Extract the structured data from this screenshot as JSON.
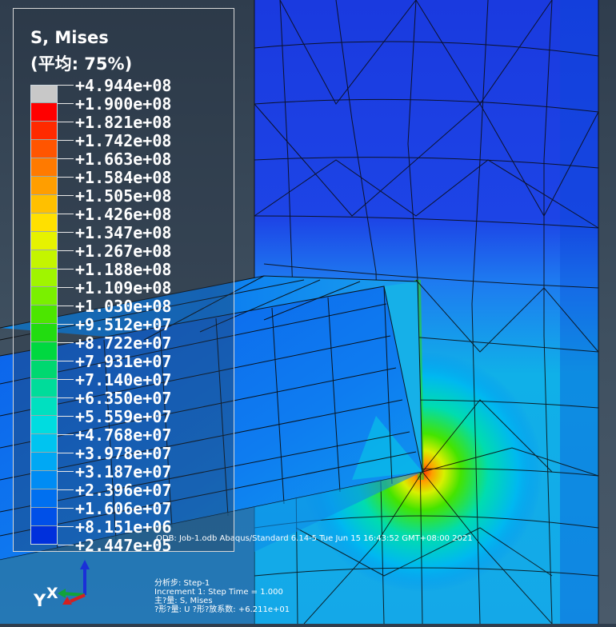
{
  "legend": {
    "title": "S, Mises",
    "subtitle": "(平均: 75%)",
    "entries": [
      {
        "label": "+4.944e+08",
        "color": "#c8c8c8"
      },
      {
        "label": "+1.900e+08",
        "color": "#ff0000"
      },
      {
        "label": "+1.821e+08",
        "color": "#ff2a00"
      },
      {
        "label": "+1.742e+08",
        "color": "#ff5500"
      },
      {
        "label": "+1.663e+08",
        "color": "#ff7a00"
      },
      {
        "label": "+1.584e+08",
        "color": "#ff9e00"
      },
      {
        "label": "+1.505e+08",
        "color": "#ffc000"
      },
      {
        "label": "+1.426e+08",
        "color": "#ffe000"
      },
      {
        "label": "+1.347e+08",
        "color": "#e6f200"
      },
      {
        "label": "+1.267e+08",
        "color": "#c4f500"
      },
      {
        "label": "+1.188e+08",
        "color": "#a0f500"
      },
      {
        "label": "+1.109e+08",
        "color": "#7af000"
      },
      {
        "label": "+1.030e+08",
        "color": "#4ce600"
      },
      {
        "label": "+9.512e+07",
        "color": "#22dc10"
      },
      {
        "label": "+8.722e+07",
        "color": "#00d840"
      },
      {
        "label": "+7.931e+07",
        "color": "#00d870"
      },
      {
        "label": "+7.140e+07",
        "color": "#00dc9a"
      },
      {
        "label": "+6.350e+07",
        "color": "#00e0c0"
      },
      {
        "label": "+5.559e+07",
        "color": "#00dce0"
      },
      {
        "label": "+4.768e+07",
        "color": "#00c4f0"
      },
      {
        "label": "+3.978e+07",
        "color": "#00a8f4"
      },
      {
        "label": "+3.187e+07",
        "color": "#008cf4"
      },
      {
        "label": "+2.396e+07",
        "color": "#0070f0"
      },
      {
        "label": "+1.606e+07",
        "color": "#0050e8"
      },
      {
        "label": "+8.151e+06",
        "color": "#0030dc"
      },
      {
        "label": "+2.447e+05",
        "color": null
      }
    ]
  },
  "info": {
    "odb_line": "ODB: Job-1.odb    Abaqus/Standard 6.14-5    Tue Jun 15 16:43:52 GMT+08:00 2021",
    "step": "分析步: Step-1",
    "increment": "Increment     1: Step Time =    1.000",
    "primary_var": "主?量: S, Mises",
    "deformed": "?形?量: U   ?形?放系数: +6.211e+01"
  },
  "triad": {
    "y_label": "Y",
    "x_label": "X"
  },
  "colors": {
    "background_top": "#2f3d4d",
    "mesh_line": "#0a0a0a",
    "deep_blue": "#1733d8",
    "hot_spot": "#ff3300"
  }
}
